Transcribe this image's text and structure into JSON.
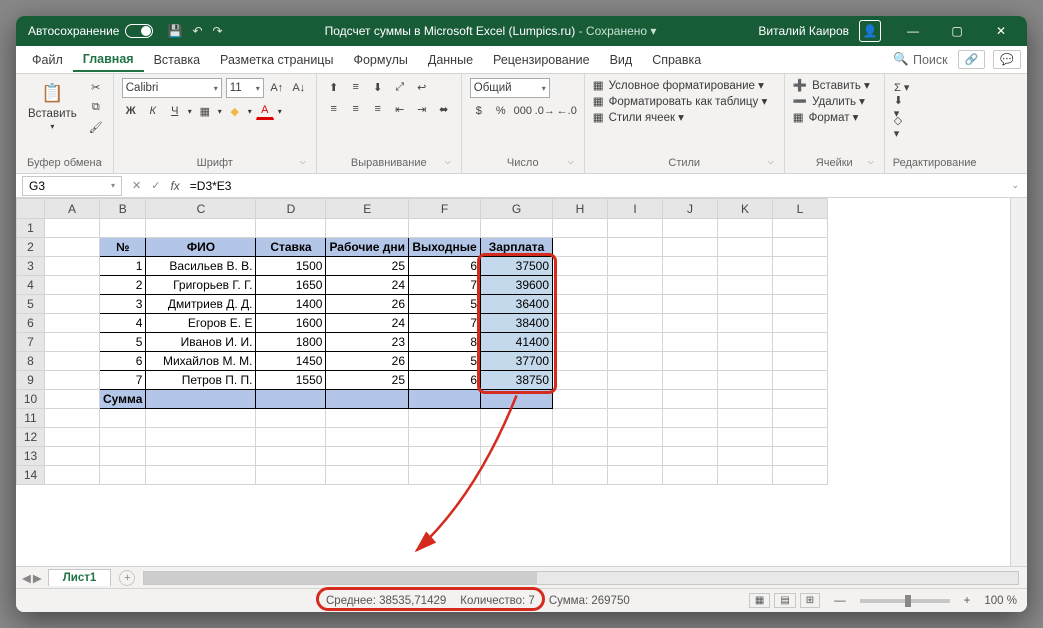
{
  "titlebar": {
    "autosave_label": "Автосохранение",
    "doc_title": "Подсчет суммы в Microsoft Excel (Lumpics.ru)",
    "saved_label": "- Сохранено ▾",
    "user": "Виталий Каиров"
  },
  "tabs": {
    "file": "Файл",
    "home": "Главная",
    "insert": "Вставка",
    "layout": "Разметка страницы",
    "formulas": "Формулы",
    "data": "Данные",
    "review": "Рецензирование",
    "view": "Вид",
    "help": "Справка",
    "search": "Поиск"
  },
  "ribbon": {
    "clipboard": {
      "paste": "Вставить",
      "label": "Буфер обмена"
    },
    "font": {
      "name": "Calibri",
      "size": "11",
      "bold": "Ж",
      "italic": "К",
      "underline": "Ч",
      "label": "Шрифт"
    },
    "alignment": {
      "label": "Выравнивание"
    },
    "number": {
      "format": "Общий",
      "label": "Число"
    },
    "styles": {
      "cond": "Условное форматирование ▾",
      "table": "Форматировать как таблицу ▾",
      "cell": "Стили ячеек ▾",
      "label": "Стили"
    },
    "cells": {
      "insert": "Вставить ▾",
      "delete": "Удалить ▾",
      "format": "Формат ▾",
      "label": "Ячейки"
    },
    "editing": {
      "label": "Редактирование"
    }
  },
  "namebox": "G3",
  "formula": "=D3*E3",
  "columns": [
    "A",
    "B",
    "C",
    "D",
    "E",
    "F",
    "G",
    "H",
    "I",
    "J",
    "K",
    "L"
  ],
  "row_numbers": [
    1,
    2,
    3,
    4,
    5,
    6,
    7,
    8,
    9,
    10,
    11,
    12,
    13,
    14
  ],
  "headers": {
    "num": "№",
    "fio": "ФИО",
    "rate": "Ставка",
    "workdays": "Рабочие дни",
    "daysoff": "Выходные",
    "salary": "Зарплата"
  },
  "rows": [
    {
      "n": 1,
      "fio": "Васильев В. В.",
      "rate": 1500,
      "days": 25,
      "off": 6,
      "sal": 37500
    },
    {
      "n": 2,
      "fio": "Григорьев Г. Г.",
      "rate": 1650,
      "days": 24,
      "off": 7,
      "sal": 39600
    },
    {
      "n": 3,
      "fio": "Дмитриев Д. Д.",
      "rate": 1400,
      "days": 26,
      "off": 5,
      "sal": 36400
    },
    {
      "n": 4,
      "fio": "Егоров Е. Е",
      "rate": 1600,
      "days": 24,
      "off": 7,
      "sal": 38400
    },
    {
      "n": 5,
      "fio": "Иванов И. И.",
      "rate": 1800,
      "days": 23,
      "off": 8,
      "sal": 41400
    },
    {
      "n": 6,
      "fio": "Михайлов М. М.",
      "rate": 1450,
      "days": 26,
      "off": 5,
      "sal": 37700
    },
    {
      "n": 7,
      "fio": "Петров П. П.",
      "rate": 1550,
      "days": 25,
      "off": 6,
      "sal": 38750
    }
  ],
  "sum_label": "Сумма",
  "sheet_tab": "Лист1",
  "status": {
    "avg_label": "Среднее:",
    "avg": "38535,71429",
    "count_label": "Количество:",
    "count": "7",
    "sum_label": "Сумма:",
    "sum": "269750",
    "zoom": "100 %"
  }
}
